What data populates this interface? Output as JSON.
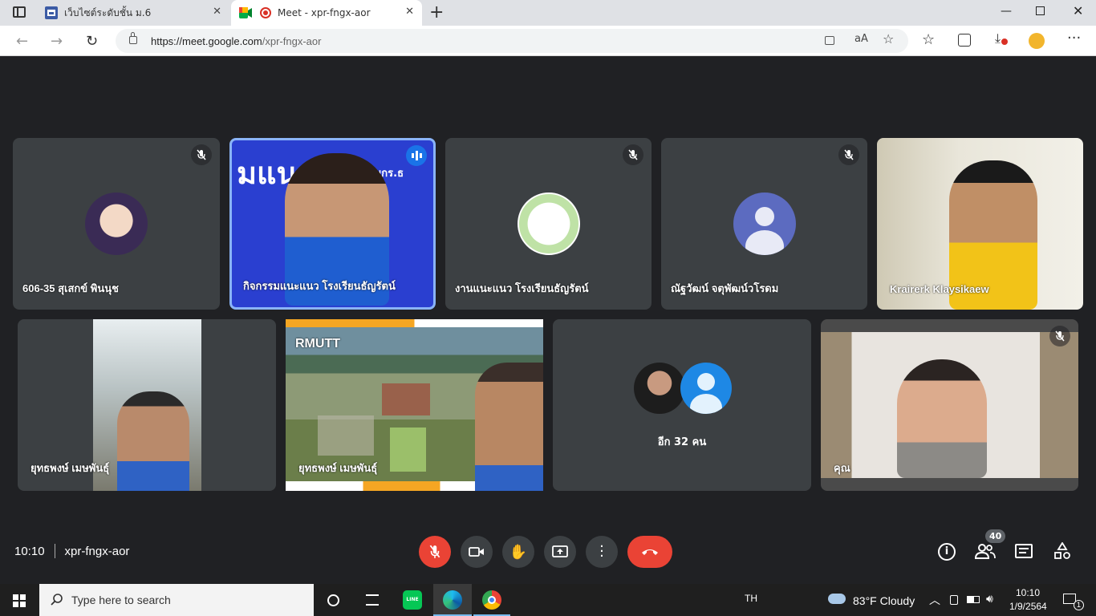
{
  "browser": {
    "tabs": [
      {
        "label": "เว็บไซต์ระดับชั้น ม.6"
      },
      {
        "label": "Meet - xpr-fngx-aor"
      }
    ],
    "url_host": "https://meet.google.com",
    "url_path": "/xpr-fngx-aor"
  },
  "tiles": [
    {
      "name": "606-35 สุเสกข์ พินนุช"
    },
    {
      "name": "กิจกรรมแนะแนว โรงเรียนธัญรัตน์",
      "banner": "มแนะแนว",
      "banner2": "มกร.ธ"
    },
    {
      "name": "งานแนะแนว โรงเรียนธัญรัตน์"
    },
    {
      "name": "ณัฐวัฒน์ จตุพัฒน์วโรดม"
    },
    {
      "name": "Krairerk Klaysikaew"
    },
    {
      "name": "ยุทธพงษ์ เมษพันธุ์"
    },
    {
      "name": "ยุทธพงษ์ เมษพันธุ์",
      "banner": "RMUTT"
    },
    {
      "name": "อีก 32 คน"
    },
    {
      "name": "คุณ"
    }
  ],
  "meeting": {
    "time": "10:10",
    "code": "xpr-fngx-aor",
    "participants_count": "40"
  },
  "colors": {
    "end_call": "#ea4335",
    "mic_off": "#ea4335",
    "speaking_border": "#8ab4f8",
    "bg": "#202124"
  },
  "taskbar": {
    "search_placeholder": "Type here to search",
    "lang": "TH",
    "weather": "83°F  Cloudy",
    "clock_time": "10:10",
    "clock_date": "1/9/2564",
    "notif_count": "1"
  }
}
